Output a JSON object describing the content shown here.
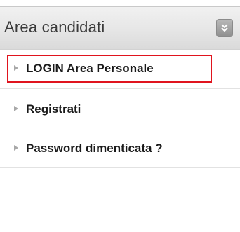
{
  "panel": {
    "title": "Area candidati",
    "collapse_icon": "chevron-double-down-icon",
    "items": [
      {
        "label": "LOGIN Area Personale",
        "icon": "triangle-right-icon",
        "highlighted": true
      },
      {
        "label": "Registrati",
        "icon": "triangle-right-icon",
        "highlighted": false
      },
      {
        "label": "Password dimenticata ?",
        "icon": "triangle-right-icon",
        "highlighted": false
      }
    ]
  },
  "colors": {
    "highlight_border": "#e0141e",
    "header_bg": "#e6e6e6",
    "text": "#1a1a1a"
  }
}
